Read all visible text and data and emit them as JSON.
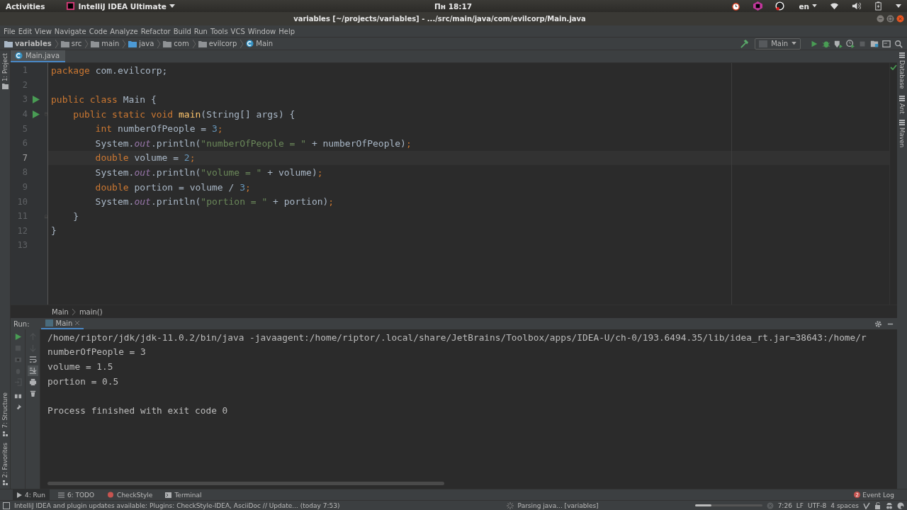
{
  "system_bar": {
    "activities": "Activities",
    "app_menu": "IntelliJ IDEA Ultimate",
    "clock": "Пн 18:17",
    "keyboard_layout": "en"
  },
  "window": {
    "title": "variables [~/projects/variables] - .../src/main/java/com/evilcorp/Main.java"
  },
  "menu": [
    "File",
    "Edit",
    "View",
    "Navigate",
    "Code",
    "Analyze",
    "Refactor",
    "Build",
    "Run",
    "Tools",
    "VCS",
    "Window",
    "Help"
  ],
  "breadcrumbs": [
    {
      "label": "variables",
      "kind": "project"
    },
    {
      "label": "src",
      "kind": "folder"
    },
    {
      "label": "main",
      "kind": "folder"
    },
    {
      "label": "java",
      "kind": "source"
    },
    {
      "label": "com",
      "kind": "package"
    },
    {
      "label": "evilcorp",
      "kind": "package"
    },
    {
      "label": "Main",
      "kind": "class"
    }
  ],
  "run_config": "Main",
  "left_tool_tabs_top": [
    "1: Project"
  ],
  "left_tool_tabs_bottom": [
    "7: Structure",
    "2: Favorites"
  ],
  "right_tool_tabs": [
    "Database",
    "Ant",
    "Maven"
  ],
  "editor": {
    "tab": "Main.java",
    "lines": [
      {
        "number": "1",
        "current": false,
        "run_marker": false,
        "fold_start": false,
        "fold_end": false,
        "tokens": [
          {
            "text": "package ",
            "kind": "keyword"
          },
          {
            "text": "com.evilcorp;",
            "kind": "plain"
          }
        ]
      },
      {
        "number": "2",
        "current": false,
        "run_marker": false,
        "fold_start": false,
        "fold_end": false
      },
      {
        "number": "3",
        "current": false,
        "run_marker": true,
        "fold_start": false,
        "fold_end": false,
        "tokens": [
          {
            "text": "public class ",
            "kind": "keyword"
          },
          {
            "text": "Main {",
            "kind": "plain"
          }
        ]
      },
      {
        "number": "4",
        "current": false,
        "run_marker": true,
        "fold_start": true,
        "fold_end": false,
        "tokens": [
          {
            "text": "    public static void ",
            "kind": "keyword"
          },
          {
            "text": "main",
            "kind": "method"
          },
          {
            "text": "(String[] args) {",
            "kind": "plain"
          }
        ]
      },
      {
        "number": "5",
        "current": false,
        "run_marker": false,
        "fold_start": false,
        "fold_end": false,
        "tokens": [
          {
            "text": "        int ",
            "kind": "keyword"
          },
          {
            "text": "numberOfPeople = ",
            "kind": "plain"
          },
          {
            "text": "3",
            "kind": "number"
          },
          {
            "text": ";",
            "kind": "keyword"
          }
        ]
      },
      {
        "number": "6",
        "current": false,
        "run_marker": false,
        "fold_start": false,
        "fold_end": false,
        "tokens": [
          {
            "text": "        System.",
            "kind": "plain"
          },
          {
            "text": "out",
            "kind": "static_field"
          },
          {
            "text": ".println(",
            "kind": "plain"
          },
          {
            "text": "\"numberOfPeople = \"",
            "kind": "string"
          },
          {
            "text": " + numberOfPeople)",
            "kind": "plain"
          },
          {
            "text": ";",
            "kind": "keyword"
          }
        ]
      },
      {
        "number": "7",
        "current": true,
        "run_marker": false,
        "fold_start": false,
        "fold_end": false,
        "tokens": [
          {
            "text": "        double ",
            "kind": "keyword"
          },
          {
            "text": "volume = ",
            "kind": "plain"
          },
          {
            "text": "2",
            "kind": "number"
          },
          {
            "text": ";",
            "kind": "keyword"
          }
        ]
      },
      {
        "number": "8",
        "current": false,
        "run_marker": false,
        "fold_start": false,
        "fold_end": false,
        "tokens": [
          {
            "text": "        System.",
            "kind": "plain"
          },
          {
            "text": "out",
            "kind": "static_field"
          },
          {
            "text": ".println(",
            "kind": "plain"
          },
          {
            "text": "\"volume = \"",
            "kind": "string"
          },
          {
            "text": " + volume)",
            "kind": "plain"
          },
          {
            "text": ";",
            "kind": "keyword"
          }
        ]
      },
      {
        "number": "9",
        "current": false,
        "run_marker": false,
        "fold_start": false,
        "fold_end": false,
        "tokens": [
          {
            "text": "        double ",
            "kind": "keyword"
          },
          {
            "text": "portion = volume / ",
            "kind": "plain"
          },
          {
            "text": "3",
            "kind": "number"
          },
          {
            "text": ";",
            "kind": "keyword"
          }
        ]
      },
      {
        "number": "10",
        "current": false,
        "run_marker": false,
        "fold_start": false,
        "fold_end": false,
        "tokens": [
          {
            "text": "        System.",
            "kind": "plain"
          },
          {
            "text": "out",
            "kind": "static_field"
          },
          {
            "text": ".println(",
            "kind": "plain"
          },
          {
            "text": "\"portion = \"",
            "kind": "string"
          },
          {
            "text": " + portion)",
            "kind": "plain"
          },
          {
            "text": ";",
            "kind": "keyword"
          }
        ]
      },
      {
        "number": "11",
        "current": false,
        "run_marker": false,
        "fold_start": false,
        "fold_end": true,
        "tokens": [
          {
            "text": "    }",
            "kind": "plain"
          }
        ]
      },
      {
        "number": "12",
        "current": false,
        "run_marker": false,
        "fold_start": false,
        "fold_end": false,
        "tokens": [
          {
            "text": "}",
            "kind": "plain"
          }
        ]
      },
      {
        "number": "13",
        "current": false,
        "run_marker": false,
        "fold_start": false,
        "fold_end": false
      }
    ]
  },
  "code_breadcrumb": [
    "Main",
    "main()"
  ],
  "run_panel": {
    "label": "Run:",
    "tab": "Main",
    "output": [
      "/home/riptor/jdk/jdk-11.0.2/bin/java -javaagent:/home/riptor/.local/share/JetBrains/Toolbox/apps/IDEA-U/ch-0/193.6494.35/lib/idea_rt.jar=38643:/home/r",
      "numberOfPeople = 3",
      "volume = 1.5",
      "portion = 0.5"
    ],
    "exit_message": "Process finished with exit code 0"
  },
  "bottom_tabs": [
    {
      "label": "4: Run",
      "selected": true,
      "kind": "run"
    },
    {
      "label": "6: TODO",
      "selected": false,
      "kind": "todo"
    },
    {
      "label": "CheckStyle",
      "selected": false,
      "kind": "checkstyle"
    },
    {
      "label": "Terminal",
      "selected": false,
      "kind": "terminal"
    }
  ],
  "event_log": {
    "label": "Event Log",
    "count": "2"
  },
  "status_bar": {
    "message": "IntelliJ IDEA and plugin updates available: Plugins: CheckStyle-IDEA, AsciiDoc // Update... (today 7:53)",
    "task": "Parsing java... [variables]",
    "progress": {
      "level": 0.25
    },
    "position": "7:26",
    "line_separator": "LF",
    "encoding": "UTF-8",
    "indent": "4 spaces"
  }
}
